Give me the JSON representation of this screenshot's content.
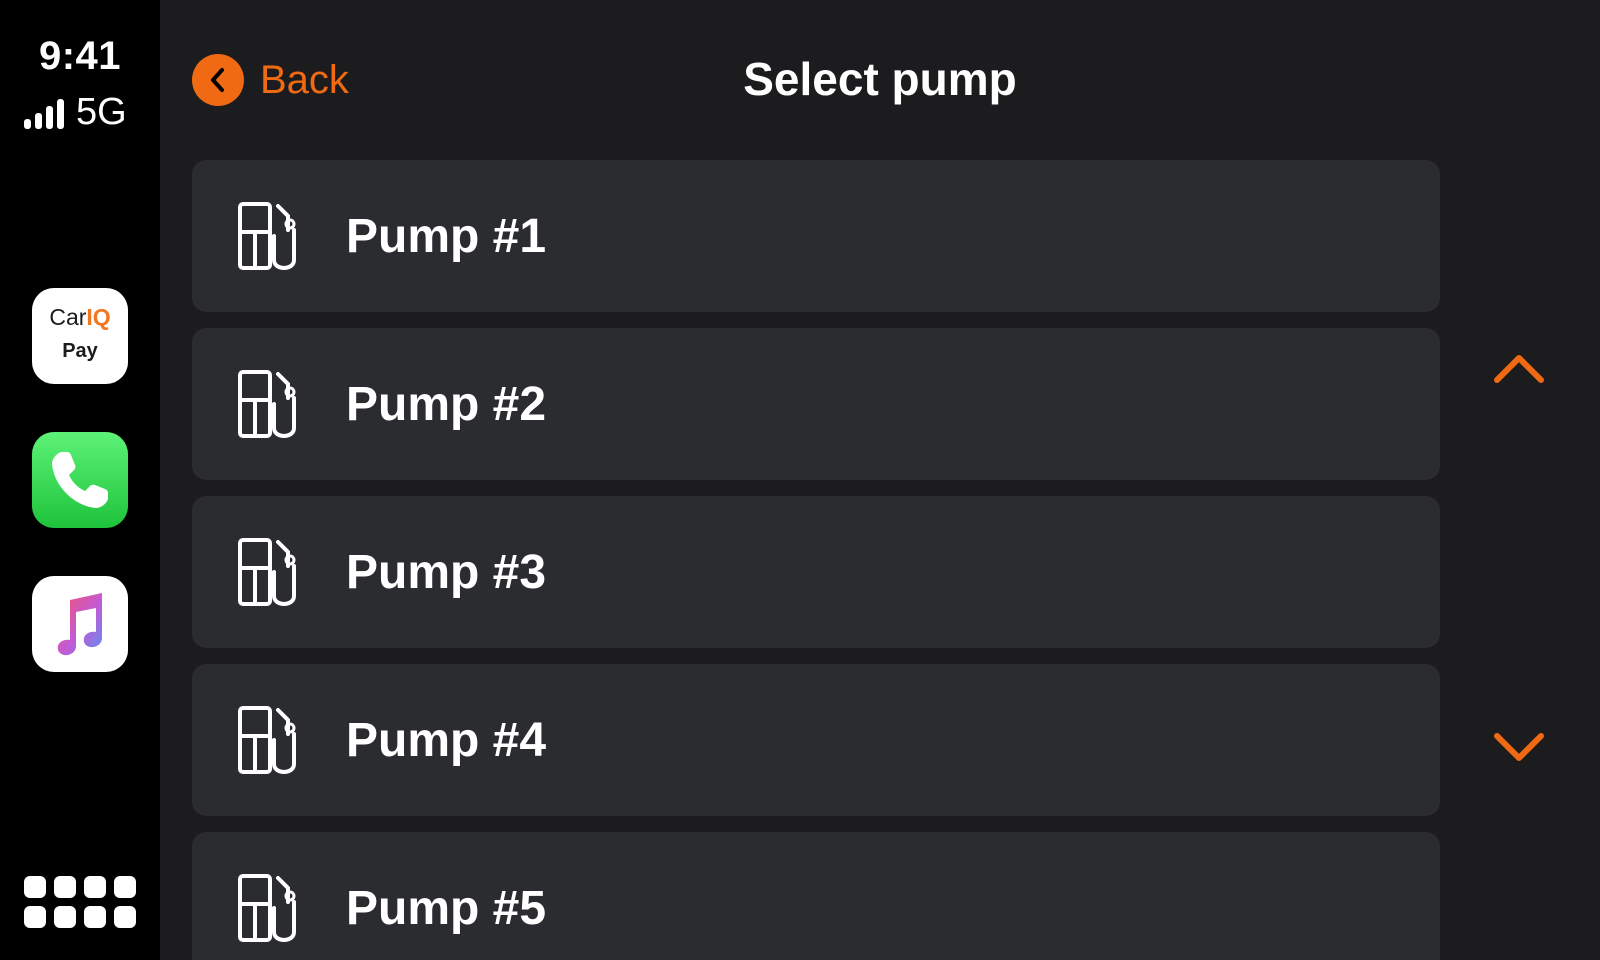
{
  "status": {
    "time": "9:41",
    "network": "5G"
  },
  "dock": {
    "apps": [
      {
        "name": "CarIQ Pay",
        "line1_prefix": "Car",
        "line1_accent": "IQ",
        "line2": "Pay",
        "icon": "cariq-pay-icon"
      },
      {
        "name": "Phone",
        "icon": "phone-icon"
      },
      {
        "name": "Music",
        "icon": "music-note-icon"
      }
    ],
    "home_icon": "app-grid-icon"
  },
  "header": {
    "back_label": "Back",
    "title": "Select pump"
  },
  "pumps": [
    {
      "label": "Pump #1",
      "icon": "fuel-pump-icon"
    },
    {
      "label": "Pump #2",
      "icon": "fuel-pump-icon"
    },
    {
      "label": "Pump #3",
      "icon": "fuel-pump-icon"
    },
    {
      "label": "Pump #4",
      "icon": "fuel-pump-icon"
    },
    {
      "label": "Pump #5",
      "icon": "fuel-pump-icon"
    }
  ],
  "scroll": {
    "up_icon": "chevron-up-icon",
    "down_icon": "chevron-down-icon"
  },
  "colors": {
    "accent": "#ef6a13",
    "background": "#1c1c1e",
    "row": "#2b2c30",
    "dock": "#000000"
  }
}
